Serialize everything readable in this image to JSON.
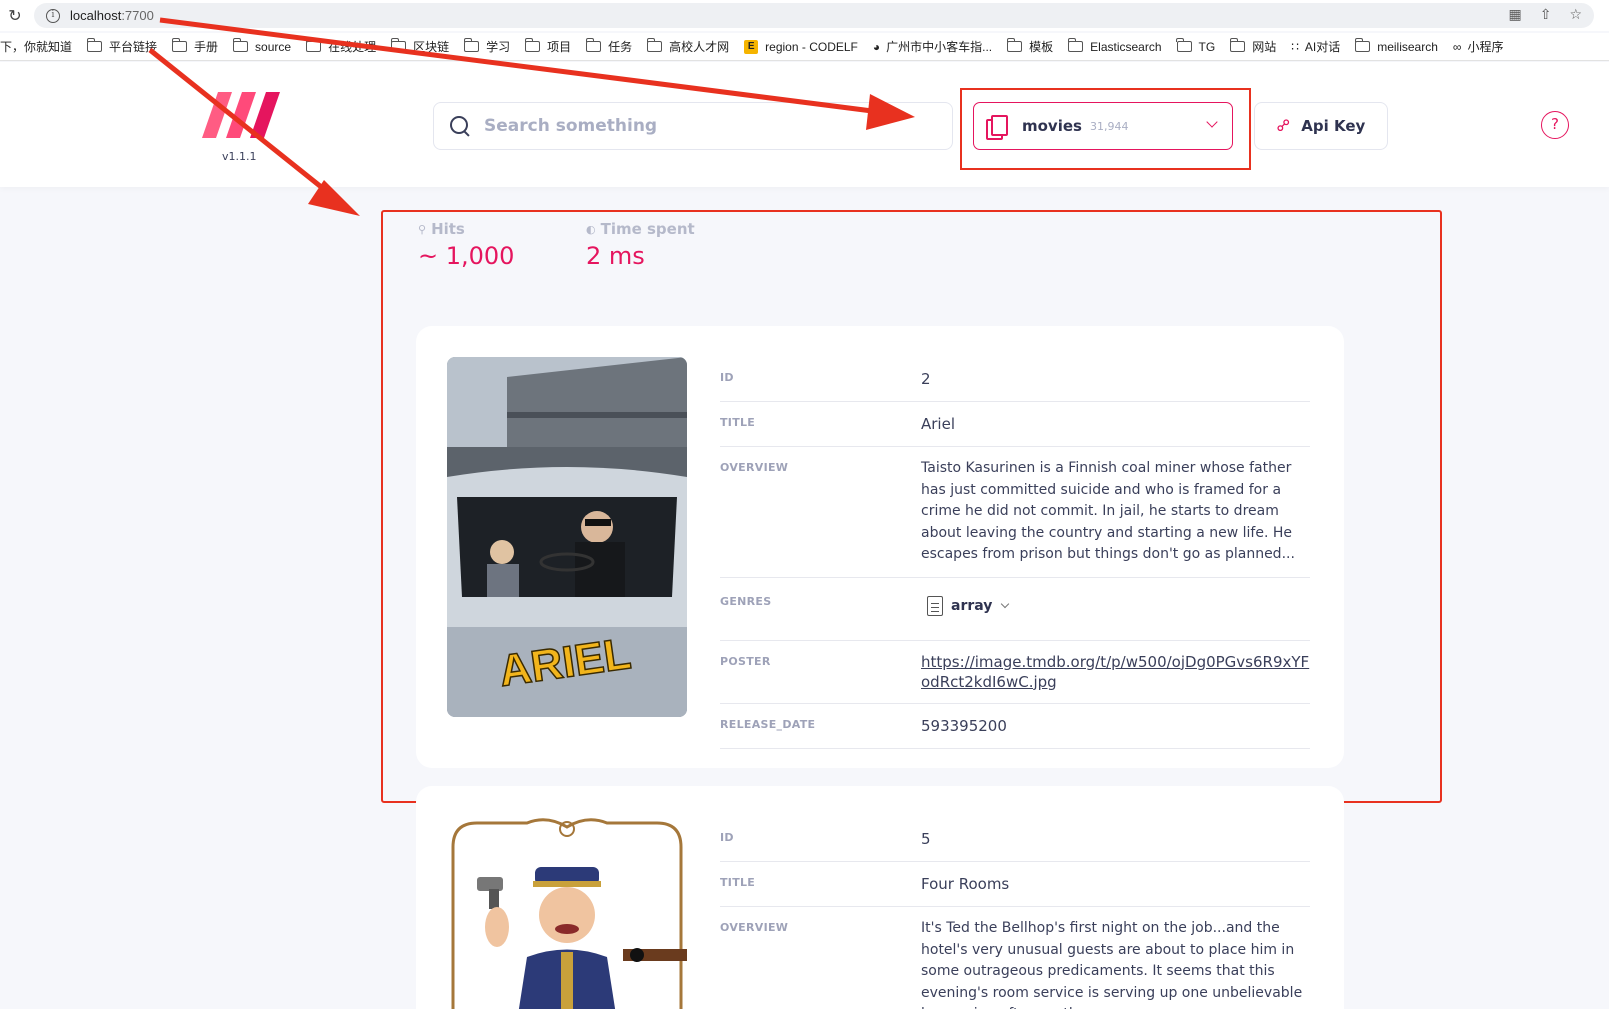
{
  "browser": {
    "url_host": "localhost",
    "url_port": ":7700",
    "bookmarks": [
      {
        "label": "下，你就知道",
        "icon": "none"
      },
      {
        "label": "平台链接",
        "icon": "folder"
      },
      {
        "label": "手册",
        "icon": "folder"
      },
      {
        "label": "source",
        "icon": "folder"
      },
      {
        "label": "在线处理",
        "icon": "folder"
      },
      {
        "label": "区块链",
        "icon": "folder"
      },
      {
        "label": "学习",
        "icon": "folder"
      },
      {
        "label": "项目",
        "icon": "folder"
      },
      {
        "label": "任务",
        "icon": "folder"
      },
      {
        "label": "高校人才网",
        "icon": "folder"
      },
      {
        "label": "region - CODELF",
        "icon": "codelf"
      },
      {
        "label": "广州市中小客车指...",
        "icon": "globe"
      },
      {
        "label": "模板",
        "icon": "folder"
      },
      {
        "label": "Elasticsearch",
        "icon": "folder"
      },
      {
        "label": "TG",
        "icon": "folder"
      },
      {
        "label": "网站",
        "icon": "folder"
      },
      {
        "label": "AI对话",
        "icon": "dots"
      },
      {
        "label": "meilisearch",
        "icon": "folder"
      },
      {
        "label": "小程序",
        "icon": "link"
      }
    ]
  },
  "header": {
    "version": "v1.1.1",
    "search_placeholder": "Search something",
    "index_name": "movies",
    "index_count": "31,944",
    "api_key_label": "Api Key",
    "help_label": "?"
  },
  "stats": {
    "hits_label": "Hits",
    "hits_value": "~ 1,000",
    "time_label": "Time spent",
    "time_value": "2 ms"
  },
  "documents": [
    {
      "poster_title": "ARIEL",
      "fields": [
        {
          "key": "ID",
          "value": "2"
        },
        {
          "key": "TITLE",
          "value": "Ariel"
        },
        {
          "key": "OVERVIEW",
          "value": "Taisto Kasurinen is a Finnish coal miner whose father has just committed suicide and who is framed for a crime he did not commit. In jail, he starts to dream about leaving the country and starting a new life. He escapes from prison but things don't go as planned..."
        },
        {
          "key": "GENRES",
          "value": "array"
        },
        {
          "key": "POSTER",
          "value": "https://image.tmdb.org/t/p/w500/ojDg0PGvs6R9xYFodRct2kdI6wC.jpg"
        },
        {
          "key": "RELEASE_DATE",
          "value": "593395200"
        }
      ]
    },
    {
      "fields": [
        {
          "key": "ID",
          "value": "5"
        },
        {
          "key": "TITLE",
          "value": "Four Rooms"
        },
        {
          "key": "OVERVIEW",
          "value": "It's Ted the Bellhop's first night on the job...and the hotel's very unusual guests are about to place him in some outrageous predicaments. It seems that this evening's room service is serving up one unbelievable happening after another."
        }
      ]
    }
  ],
  "colors": {
    "accent": "#e5155e",
    "annotation": "#e8311f"
  }
}
